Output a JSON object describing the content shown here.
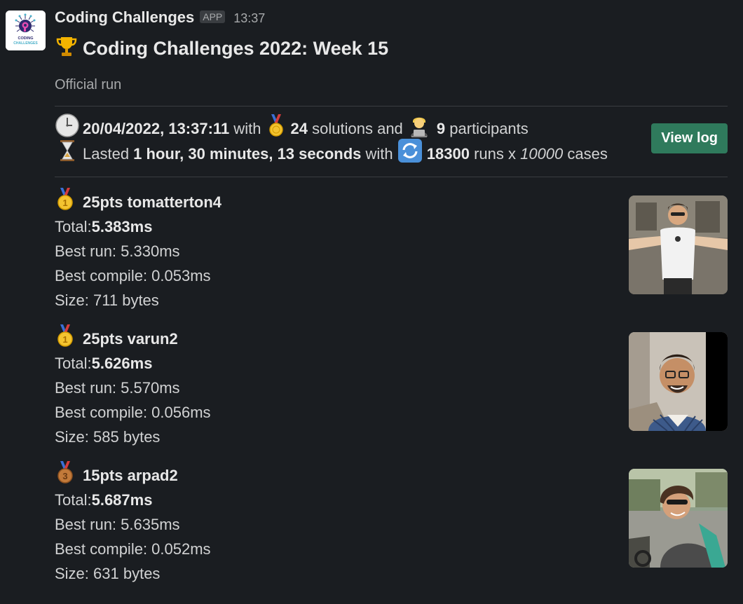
{
  "message": {
    "sender": "Coding Challenges",
    "app_badge": "APP",
    "timestamp": "13:37",
    "logo_text_line1": "CODING",
    "logo_text_line2": "CHALLENGES",
    "title": "Coding Challenges 2022: Week 15",
    "subtitle": "Official run",
    "run": {
      "datetime": "20/04/2022, 13:37:11",
      "with": " with ",
      "solutions_count": "24",
      "solutions_and": " solutions and ",
      "participants_count": "9",
      "participants_label": " participants",
      "lasted": "Lasted ",
      "duration": "1 hour, 30 minutes, 13 seconds",
      "with2": " with ",
      "runs_count": "18300",
      "runs_x": " runs x ",
      "cases_count": "10000",
      "cases_label": " cases"
    },
    "view_log_label": "View log"
  },
  "results": [
    {
      "medal": "gold",
      "header": "25pts tomatterton4",
      "total_label": "Total: ",
      "total_value": "5.383ms",
      "best_run": "Best run: 5.330ms",
      "best_compile": "Best compile: 0.053ms",
      "size": "Size: 711 bytes"
    },
    {
      "medal": "gold",
      "header": "25pts varun2",
      "total_label": "Total: ",
      "total_value": "5.626ms",
      "best_run": "Best run: 5.570ms",
      "best_compile": "Best compile: 0.056ms",
      "size": "Size: 585 bytes"
    },
    {
      "medal": "bronze",
      "header": "15pts arpad2",
      "total_label": "Total: ",
      "total_value": "5.687ms",
      "best_run": "Best run: 5.635ms",
      "best_compile": "Best compile: 0.052ms",
      "size": "Size: 631 bytes"
    }
  ],
  "colors": {
    "background": "#1a1d21",
    "button": "#2f7a5c",
    "text": "#d1d2d3"
  },
  "icons": [
    "trophy-icon",
    "clock-icon",
    "medal-icon",
    "technologist-icon",
    "hourglass-icon",
    "repeat-icon",
    "gold-medal-icon",
    "bronze-medal-icon"
  ]
}
